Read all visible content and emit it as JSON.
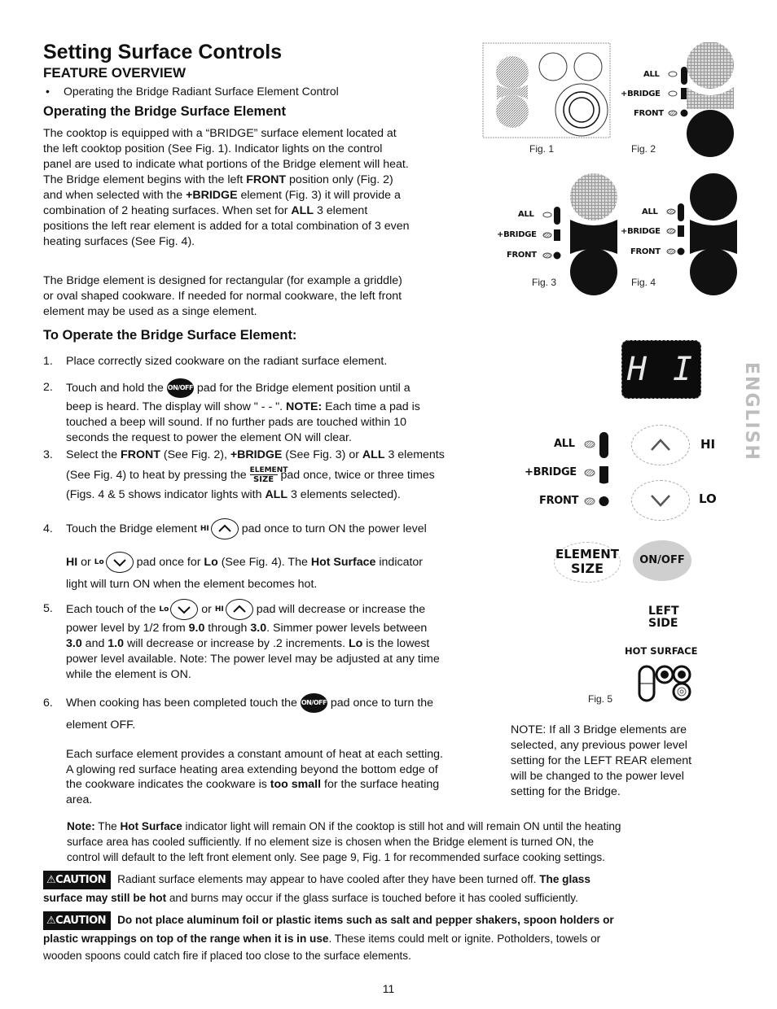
{
  "header": {
    "title": "Setting Surface Controls",
    "subtitle": "FEATURE OVERVIEW",
    "bullet": "Operating the Bridge Radiant Surface Element Control"
  },
  "section1": {
    "heading": "Operating the Bridge Surface Element",
    "para1": [
      "The cooktop is equipped with a “BRIDGE” surface element located at",
      "the left cooktop position (See Fig. 1). Indicator lights on the control",
      "panel are used to indicate what portions of the Bridge element will heat.",
      "The Bridge element begins with the left ",
      "FRONT",
      " position only (Fig. 2)",
      "and when selected with the ",
      "+BRIDGE",
      " element (Fig. 3) it will provide a",
      "combination of 2 heating surfaces. When set for ",
      "ALL",
      " 3 element",
      "positions the left rear element is added for a total combination of 3 even",
      "heating surfaces (See Fig. 4)."
    ],
    "para2": [
      "The Bridge element is designed for rectangular (for example a griddle)",
      "or oval shaped cookware.  If needed for normal cookware, the left front",
      "element may be used as a singe element."
    ]
  },
  "section2": {
    "heading": "To Operate the Bridge Surface Element:",
    "steps": {
      "s1": {
        "num": "1.",
        "text": "Place correctly sized cookware on the radiant surface element."
      },
      "s2": {
        "num": "2.",
        "a": "Touch and hold the",
        "b": "pad for the Bridge element position until a",
        "c": "beep is heard. The display will show \" - - \". ",
        "note": "NOTE:",
        "d": " Each time a pad is",
        "e": "touched a beep will sound. If no further pads are touched within 10",
        "f": "seconds the request to power the element ON will clear."
      },
      "s3": {
        "num": "3.",
        "a": "Select the ",
        "front": "FRONT",
        "b": " (See Fig. 2), ",
        "bridge": "+BRIDGE",
        "c": " (See Fig. 3) or ",
        "all": "ALL",
        "d": " 3 elements",
        "e": "(See Fig. 4) to heat by pressing the",
        "f": "pad once, twice or three times",
        "g": "(Figs. 4 & 5 shows indicator lights with ",
        "h": " 3 elements selected)."
      },
      "s4": {
        "num": "4.",
        "a": "Touch the Bridge element",
        "b": "pad once to turn ON the power level",
        "hi": "HI",
        "c": " or",
        "d": "pad once for ",
        "lo": "Lo",
        "e": " (See Fig. 4). The ",
        "hot": "Hot Surface",
        "f": " indicator",
        "g": "light will turn ON when the element becomes hot."
      },
      "s5": {
        "num": "5.",
        "a": "Each touch of the",
        "b": "or",
        "c": "pad will decrease or increase the",
        "d": "power level by 1/2 from ",
        "v9": "9.0",
        "e": " through ",
        "v3": "3.0",
        "f": ". Simmer power levels between",
        "v3b": "3.0",
        "g": " and ",
        "v1": "1.0",
        "h": " will decrease or increase by .2 increments. ",
        "lo": "Lo",
        "i": " is the lowest",
        "j": "power level available. Note: The power level may be adjusted at any time",
        "k": "while the element is ON."
      },
      "s6": {
        "num": "6.",
        "a": "When cooking has been completed touch the",
        "b": "pad once to turn the",
        "c": "element OFF."
      }
    },
    "heat_para": {
      "a": "Each surface element provides a constant amount of heat at each setting.",
      "b": "A glowing red surface heating area extending beyond the bottom edge of",
      "c": "the cookware indicates the cookware is ",
      "bold": "too small",
      "d": " for the surface heating",
      "e": "area."
    }
  },
  "pads": {
    "onoff": "ON/OFF",
    "hi": "HI",
    "lo": "Lo",
    "element": "ELEMENT",
    "size": "SIZE"
  },
  "figures": {
    "fig1": "Fig. 1",
    "fig2": "Fig. 2",
    "fig3": "Fig. 3",
    "fig4": "Fig. 4",
    "fig5": "Fig. 5",
    "labels": {
      "all": "ALL",
      "bridge": "+BRIDGE",
      "front": "FRONT"
    },
    "display": "H I",
    "hi": "HI",
    "lo": "LO",
    "element_size_1": "ELEMENT",
    "element_size_2": "SIZE",
    "onoff": "ON/OFF",
    "left": "LEFT",
    "side": "SIDE",
    "hot_surface": "HOT SURFACE"
  },
  "side_note": [
    "NOTE: If all 3 Bridge elements are",
    "selected, any previous power level",
    "setting for the LEFT REAR element",
    "will be changed to the power level",
    "setting for the Bridge."
  ],
  "note": {
    "label": "Note:",
    "a": " The ",
    "hot": "Hot Surface",
    "b": " indicator light will remain ON if the cooktop is still hot and will remain ON until the heating",
    "c": "surface area has cooled sufficiently. If no element size is chosen when the Bridge element is turned ON, the",
    "d": "control will default to the left front element only. See page 9, Fig. 1 for recommended surface cooking settings."
  },
  "cautions": [
    {
      "badge": "CAUTION",
      "a": "Radiant surface elements may appear to have cooled after they have been turned off. ",
      "bold": "The glass",
      "bold2": "surface may still be hot",
      "b": " and burns may occur if the glass surface is touched before it has cooled sufficiently."
    },
    {
      "badge": "CAUTION",
      "bold": "Do not place aluminum foil or plastic items such as salt and pepper shakers, spoon holders or",
      "bold2": "plastic wrappings on top of the range when it is in use",
      "b": ". These items could melt or ignite. Potholders, towels or",
      "c": "wooden spoons could catch fire if placed too close to the surface elements."
    }
  ],
  "side_tab": "ENGLISH",
  "page_number": "11"
}
